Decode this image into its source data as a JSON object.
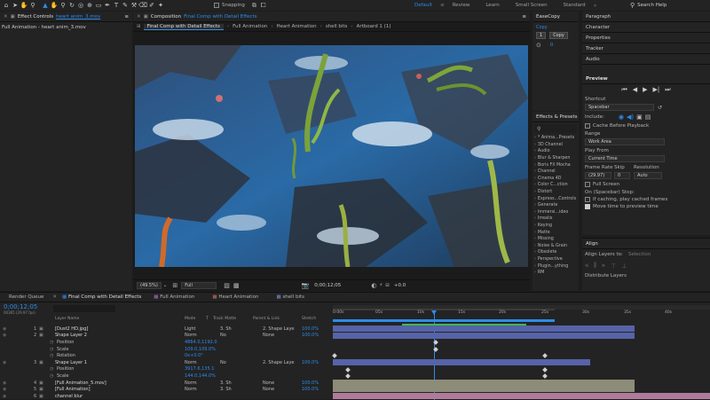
{
  "menu": {
    "workspaces": [
      "Default",
      "Review",
      "Learn",
      "Small Screen",
      "Standard"
    ],
    "active_workspace": "Default",
    "snapping": "Snapping",
    "search_placeholder": "Search Help"
  },
  "effect_controls": {
    "title": "Effect Controls",
    "file": "heart anim_3.mov",
    "subject": "Full Animation - heart anim_3.mov"
  },
  "composition": {
    "title": "Composition",
    "name": "Final Comp with Detail Effects",
    "tabs": [
      "Final Comp with Detail Effects",
      "Full Animation",
      "Heart Animation",
      "shell bits",
      "Artboard 1 (1)"
    ],
    "zoom": "(49.5%)",
    "resolution": "Full",
    "timecode": "0;00;12;05",
    "exposure": "+0.0"
  },
  "easecopy": {
    "title": "EaseCopy",
    "copy_label": "Copy",
    "copy_value": "1",
    "copy_button": "Copy",
    "paste_value": "0"
  },
  "effects_presets": {
    "title": "Effects & Presets",
    "search_placeholder": "",
    "items": [
      "* Anima...Presets",
      "3D Channel",
      "Audio",
      "Blur & Sharpen",
      "Boris FX Mocha",
      "Channel",
      "Cinema 4D",
      "Color C...ction",
      "Distort",
      "Express...Controls",
      "Generate",
      "Immersi...ideo",
      "Irrealix",
      "Keying",
      "Matte",
      "Missing",
      "Noise & Grain",
      "Obsolete",
      "Perspective",
      "Plugin...ything",
      "RM"
    ]
  },
  "right_panels": [
    "Paragraph",
    "Character",
    "Properties",
    "Tracker",
    "Audio"
  ],
  "preview": {
    "title": "Preview",
    "shortcut_label": "Shortcut",
    "shortcut": "Spacebar",
    "include_label": "Include:",
    "cache_label": "Cache Before Playback",
    "range_label": "Range",
    "range": "Work Area",
    "play_from_label": "Play From",
    "play_from": "Current Time",
    "frame_rate_label": "Frame Rate",
    "skip_label": "Skip",
    "resolution_label": "Resolution",
    "frame_rate": "(29.97)",
    "skip": "0",
    "resolution": "Auto",
    "fullscreen_label": "Full Screen",
    "on_stop_label": "On (Spacebar) Stop:",
    "if_caching_label": "If caching, play cached frames",
    "move_time_label": "Move time to preview time",
    "cache_checked": false,
    "fullscreen_checked": false,
    "if_caching_checked": false,
    "move_time_checked": true
  },
  "align": {
    "title": "Align",
    "align_layers_label": "Align Layers to:",
    "align_to": "Selection",
    "distribute_label": "Distribute Layers"
  },
  "timeline": {
    "tabs": [
      "Render Queue",
      "Final Comp with Detail Effects",
      "Full Animation",
      "Heart Animation",
      "shell bits"
    ],
    "active_tab": "Final Comp with Detail Effects",
    "timecode": "0;00;12;05",
    "fps_note": "00365 (29.97 fps)",
    "columns": {
      "layer_name": "Layer Name",
      "mode": "Mode",
      "t": "T",
      "track_matte": "Track Matte",
      "parent": "Parent & Link",
      "stretch": "Stretch"
    },
    "ruler": [
      "0:00s",
      "05s",
      "10s",
      "15s",
      "20s",
      "25s",
      "30s",
      "35s",
      "40s"
    ],
    "rows": [
      {
        "num": "1",
        "name": "[Dust2 HD.jpg]",
        "mode": "Light",
        "matte": "3. Sh",
        "parent": "2. Shape Laye",
        "stretch": "100.0%"
      },
      {
        "num": "2",
        "name": "Shape Layer 2",
        "mode": "Norm",
        "matte": "No",
        "parent": "None",
        "stretch": "100.0%"
      },
      {
        "num": "",
        "name": "Position",
        "value": "4864.0,1192.0"
      },
      {
        "num": "",
        "name": "Scale",
        "value": "109.0,109.0%"
      },
      {
        "num": "",
        "name": "Rotation",
        "value": "0x+0.0°"
      },
      {
        "num": "3",
        "name": "Shape Layer 1",
        "mode": "Norm",
        "matte": "No",
        "parent": "2. Shape Laye",
        "stretch": "100.0%"
      },
      {
        "num": "",
        "name": "Position",
        "value": "3917.6,135.1"
      },
      {
        "num": "",
        "name": "Scale",
        "value": "144.0,144.0%"
      },
      {
        "num": "4",
        "name": "[Full Animation_5.mov]",
        "mode": "Norm",
        "matte": "3. Sh",
        "parent": "None",
        "stretch": "100.0%"
      },
      {
        "num": "5",
        "name": "[Full Animation]",
        "mode": "Norm",
        "matte": "3. Sh",
        "parent": "None",
        "stretch": "100.0%"
      },
      {
        "num": "6",
        "name": "channel blur",
        "mode": "",
        "matte": "",
        "parent": "",
        "stretch": ""
      }
    ]
  },
  "colors": {
    "accent": "#2d8ceb",
    "panel": "#232323",
    "background": "#1d1d1d",
    "track_blue": "#5663a8",
    "track_tan": "#8c8c78",
    "track_pink": "#b07a9a"
  }
}
